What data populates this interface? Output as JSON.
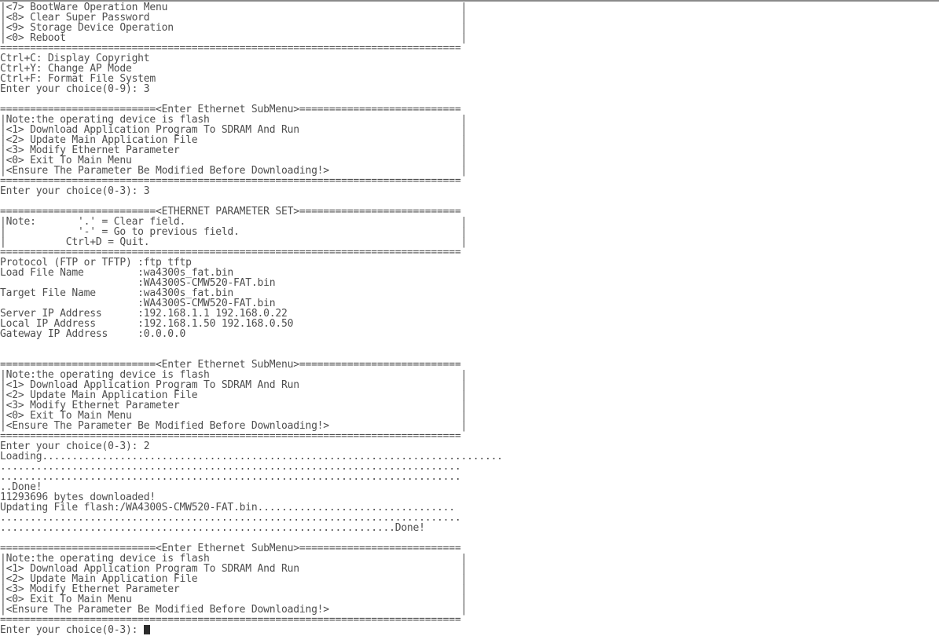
{
  "terminal": {
    "lines": [
      "|<7> BootWare Operation Menu                                                 |",
      "|<8> Clear Super Password                                                    |",
      "|<9> Storage Device Operation                                                |",
      "|<0> Reboot                                                                  |",
      "=============================================================================",
      "Ctrl+C: Display Copyright",
      "Ctrl+Y: Change AP Mode",
      "Ctrl+F: Format File System",
      "Enter your choice(0-9): 3",
      "",
      "==========================<Enter Ethernet SubMenu>===========================",
      "|Note:the operating device is flash                                          |",
      "|<1> Download Application Program To SDRAM And Run                           |",
      "|<2> Update Main Application File                                            |",
      "|<3> Modify Ethernet Parameter                                               |",
      "|<0> Exit To Main Menu                                                       |",
      "|<Ensure The Parameter Be Modified Before Downloading!>                      |",
      "=============================================================================",
      "Enter your choice(0-3): 3",
      "",
      "==========================<ETHERNET PARAMETER SET>===========================",
      "|Note:       '.' = Clear field.                                              |",
      "|            '-' = Go to previous field.                                     |",
      "|          Ctrl+D = Quit.                                                    |",
      "=============================================================================",
      "Protocol (FTP or TFTP) :ftp tftp",
      "Load File Name         :wa4300s_fat.bin",
      "                       :WA4300S-CMW520-FAT.bin",
      "Target File Name       :wa4300s_fat.bin",
      "                       :WA4300S-CMW520-FAT.bin",
      "Server IP Address      :192.168.1.1 192.168.0.22",
      "Local IP Address       :192.168.1.50 192.168.0.50",
      "Gateway IP Address     :0.0.0.0",
      "",
      "",
      "==========================<Enter Ethernet SubMenu>===========================",
      "|Note:the operating device is flash                                          |",
      "|<1> Download Application Program To SDRAM And Run                           |",
      "|<2> Update Main Application File                                            |",
      "|<3> Modify Ethernet Parameter                                               |",
      "|<0> Exit To Main Menu                                                       |",
      "|<Ensure The Parameter Be Modified Before Downloading!>                      |",
      "=============================================================================",
      "Enter your choice(0-3): 2",
      "Loading.............................................................................",
      ".............................................................................",
      ".............................................................................",
      "..Done!",
      "11293696 bytes downloaded!",
      "Updating File flash:/WA4300S-CMW520-FAT.bin.................................",
      ".............................................................................",
      "..................................................................Done!",
      "",
      "==========================<Enter Ethernet SubMenu>===========================",
      "|Note:the operating device is flash                                          |",
      "|<1> Download Application Program To SDRAM And Run                           |",
      "|<2> Update Main Application File                                            |",
      "|<3> Modify Ethernet Parameter                                               |",
      "|<0> Exit To Main Menu                                                       |",
      "|<Ensure The Parameter Be Modified Before Downloading!>                      |",
      "=============================================================================",
      "Enter your choice(0-3):"
    ]
  },
  "colors": {
    "text": "#4e4e4e",
    "background": "#ffffff",
    "cursor": "#2c2c2c",
    "top_border": "#8a8a8a"
  }
}
